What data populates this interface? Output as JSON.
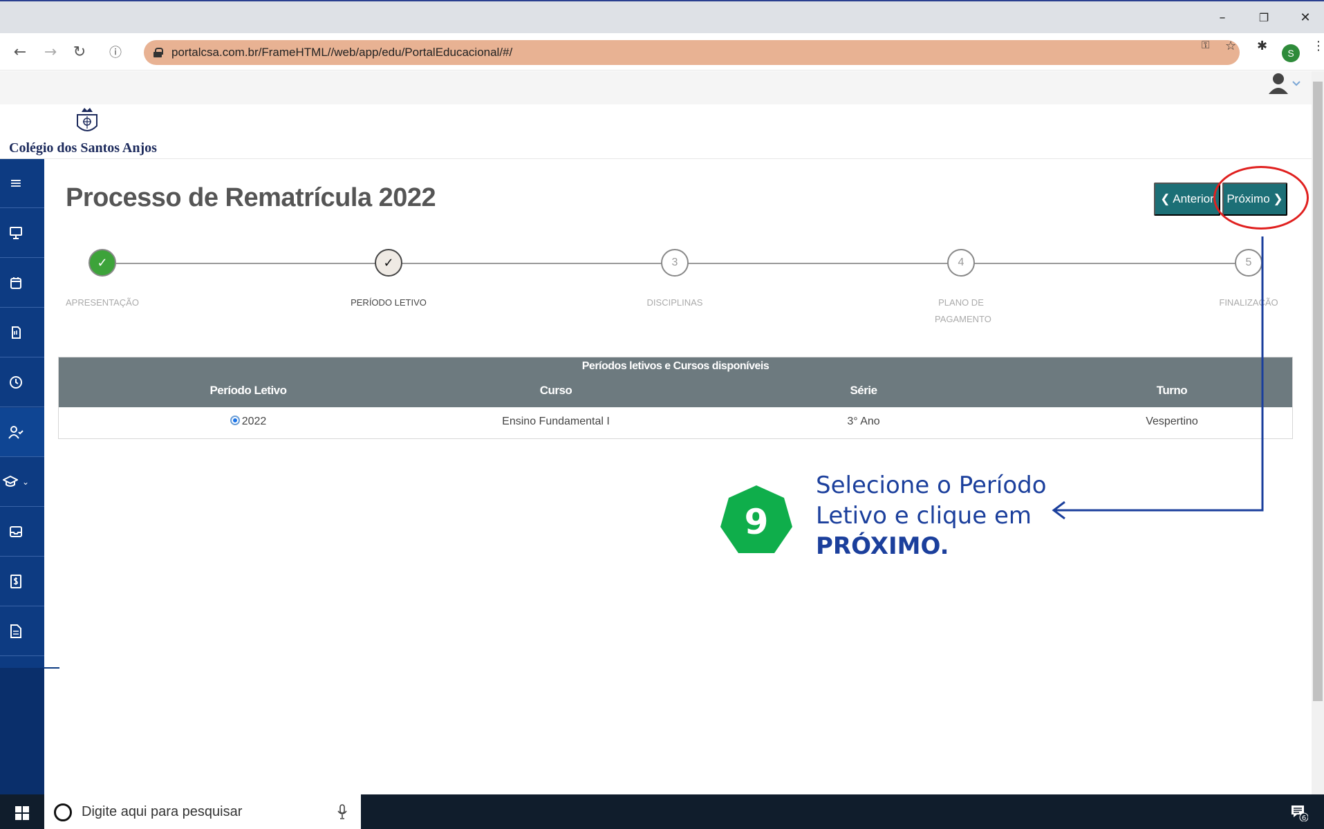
{
  "browser": {
    "url": "portalcsa.com.br/FrameHTML//web/app/edu/PortalEducacional/#/",
    "profile_initial": "S",
    "minimize_glyph": "–",
    "restore_glyph": "❐",
    "close_glyph": "✕"
  },
  "header": {
    "school_name": "Colégio dos Santos Anjos"
  },
  "page": {
    "title": "Processo de Rematrícula 2022",
    "prev_label": "❮ Anterior",
    "next_label": "Próximo ❯"
  },
  "stepper": {
    "steps": [
      {
        "number": "✓",
        "label": "APRESENTAÇÃO",
        "state": "done"
      },
      {
        "number": "✓",
        "label": "PERÍODO LETIVO",
        "state": "current"
      },
      {
        "number": "3",
        "label": "DISCIPLINAS",
        "state": "pending"
      },
      {
        "number": "4",
        "label": "PLANO DE PAGAMENTO",
        "state": "pending"
      },
      {
        "number": "5",
        "label": "FINALIZAÇÃO",
        "state": "pending"
      }
    ]
  },
  "table": {
    "caption": "Períodos letivos e Cursos disponíveis",
    "columns": [
      "Período Letivo",
      "Curso",
      "Série",
      "Turno"
    ],
    "rows": [
      {
        "periodo": "2022",
        "curso": "Ensino Fundamental I",
        "serie": "3° Ano",
        "turno": "Vespertino",
        "selected": true
      }
    ]
  },
  "annotation": {
    "number": "9",
    "line1": "Selecione o Período",
    "line2": "Letivo e clique em",
    "line3": "PRÓXIMO."
  },
  "taskbar": {
    "search_placeholder": "Digite aqui para pesquisar",
    "notification_count": "6"
  },
  "colors": {
    "sidebar": "#0d3b82",
    "primary_button": "#1c6f76",
    "table_header": "#6d7a7f",
    "step_done": "#3da33a",
    "annotation_text": "#1b3f9c",
    "annotation_badge": "#0fae4b",
    "highlight_circle": "#e0201f"
  },
  "icons": {
    "sidebar": [
      "menu-icon",
      "monitor-icon",
      "calendar-icon",
      "document-hand-icon",
      "clock-icon",
      "user-check-icon",
      "graduation-cap-icon",
      "inbox-icon",
      "money-document-icon",
      "file-icon"
    ]
  }
}
